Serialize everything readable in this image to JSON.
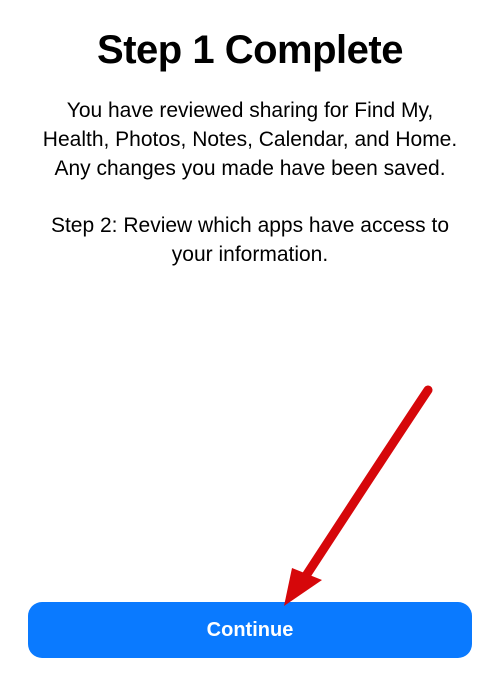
{
  "header": {
    "title": "Step 1 Complete"
  },
  "body": {
    "paragraph1": "You have reviewed sharing for Find My, Health, Photos, Notes, Calendar, and Home. Any changes you made have been saved.",
    "paragraph2": "Step 2: Review which apps have access to your information."
  },
  "actions": {
    "continue_label": "Continue"
  },
  "colors": {
    "primary": "#0a7aff",
    "annotation": "#d6070a"
  }
}
